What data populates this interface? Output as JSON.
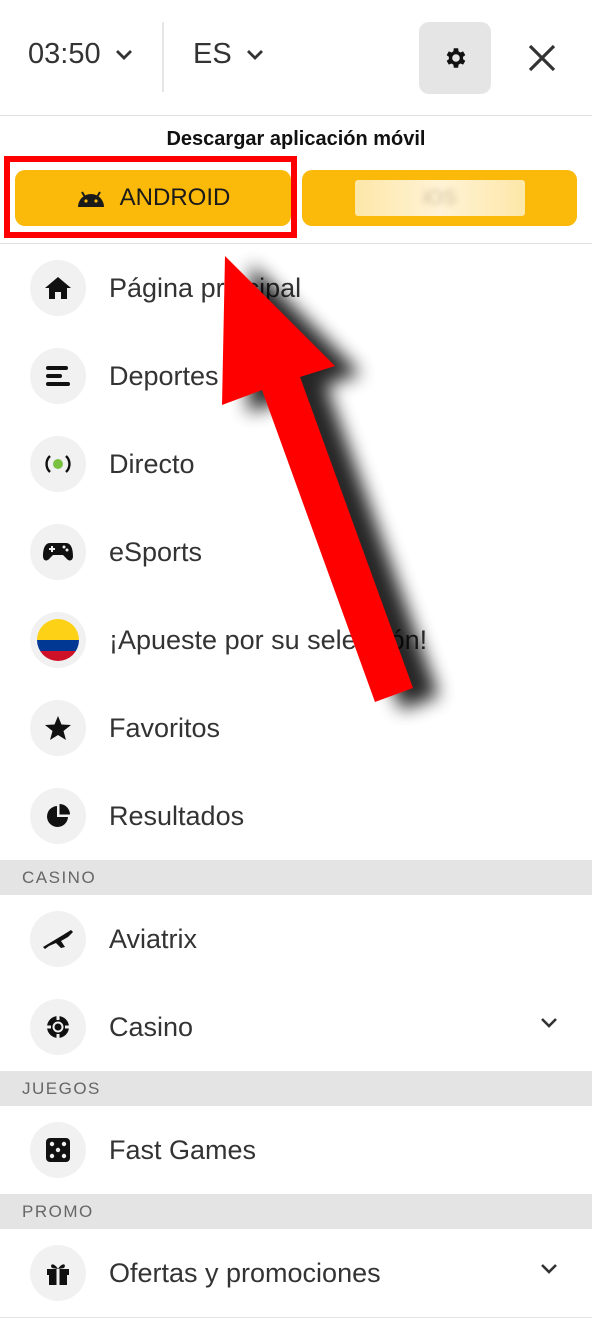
{
  "header": {
    "time": "03:50",
    "language": "ES"
  },
  "download": {
    "title": "Descargar aplicación móvil",
    "android_label": "ANDROID",
    "ios_label": "iOS"
  },
  "menu": {
    "home": "Página principal",
    "sports": "Deportes",
    "live": "Directo",
    "esports": "eSports",
    "bet_team": "¡Apueste por su selección!",
    "favorites": "Favoritos",
    "results": "Resultados",
    "casino_section": "CASINO",
    "aviatrix": "Aviatrix",
    "casino": "Casino",
    "games_section": "JUEGOS",
    "fast_games": "Fast Games",
    "promo_section": "PROMO",
    "offers": "Ofertas y promociones"
  },
  "colors": {
    "accent": "#fbb909",
    "annotation": "#ff0000"
  }
}
